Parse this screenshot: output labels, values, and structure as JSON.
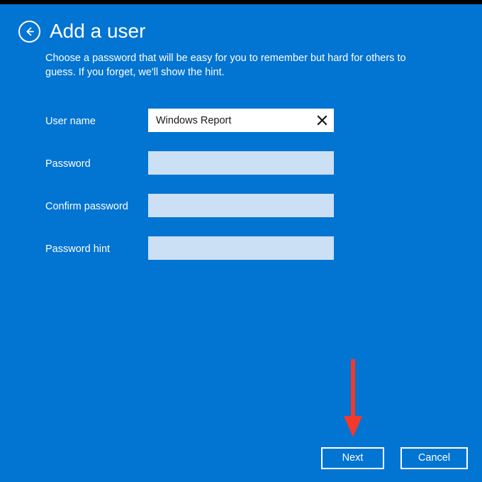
{
  "window": {
    "background_color": "#0274d2",
    "top_bar_color": "#000000"
  },
  "header": {
    "back_icon": "back-arrow-circle-icon",
    "title": "Add a user",
    "subtitle": "Choose a password that will be easy for you to remember but hard for others to guess. If you forget, we'll show the hint."
  },
  "form": {
    "fields": [
      {
        "label": "User name",
        "value": "Windows Report",
        "placeholder": "",
        "filled": true,
        "clear_icon": "close-x-icon"
      },
      {
        "label": "Password",
        "value": "",
        "placeholder": "",
        "filled": false,
        "clear_icon": ""
      },
      {
        "label": "Confirm password",
        "value": "",
        "placeholder": "",
        "filled": false,
        "clear_icon": ""
      },
      {
        "label": "Password hint",
        "value": "",
        "placeholder": "",
        "filled": false,
        "clear_icon": ""
      }
    ],
    "empty_field_color": "#cbe0f4",
    "filled_field_color": "#ffffff"
  },
  "annotation": {
    "arrow_icon": "down-arrow-annotation-icon",
    "color": "#f2392c",
    "points_to": "Next"
  },
  "footer": {
    "next_label": "Next",
    "cancel_label": "Cancel"
  }
}
